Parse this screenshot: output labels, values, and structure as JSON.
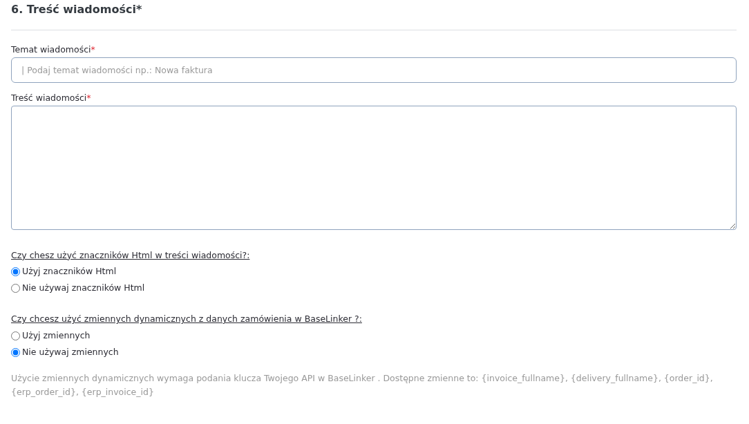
{
  "section_title": "6. Treść wiadomości*",
  "subject": {
    "label": "Temat wiadomości",
    "required_mark": "*",
    "placeholder": "| Podaj temat wiadomości np.: Nowa faktura"
  },
  "body": {
    "label": "Treść wiadomości",
    "required_mark": "*"
  },
  "questions": [
    {
      "text": "Czy chesz użyć znaczników Html w treści wiadomości?:",
      "options": [
        {
          "label": "Użyj znaczników Html",
          "selected": true
        },
        {
          "label": "Nie używaj znaczników Html",
          "selected": false
        }
      ]
    },
    {
      "text": "Czy chcesz użyć zmiennych dynamicznych z danych zamówienia w BaseLinker ?:",
      "options": [
        {
          "label": "Użyj zmiennych",
          "selected": false
        },
        {
          "label": "Nie używaj zmiennych",
          "selected": true
        }
      ]
    }
  ],
  "help_text": "Użycie zmiennych dynamicznych wymaga podania klucza Twojego API w BaseLinker . Dostępne zmienne to: {invoice_fullname}, {delivery_fullname}, {order_id}, {erp_order_id}, {erp_invoice_id}"
}
